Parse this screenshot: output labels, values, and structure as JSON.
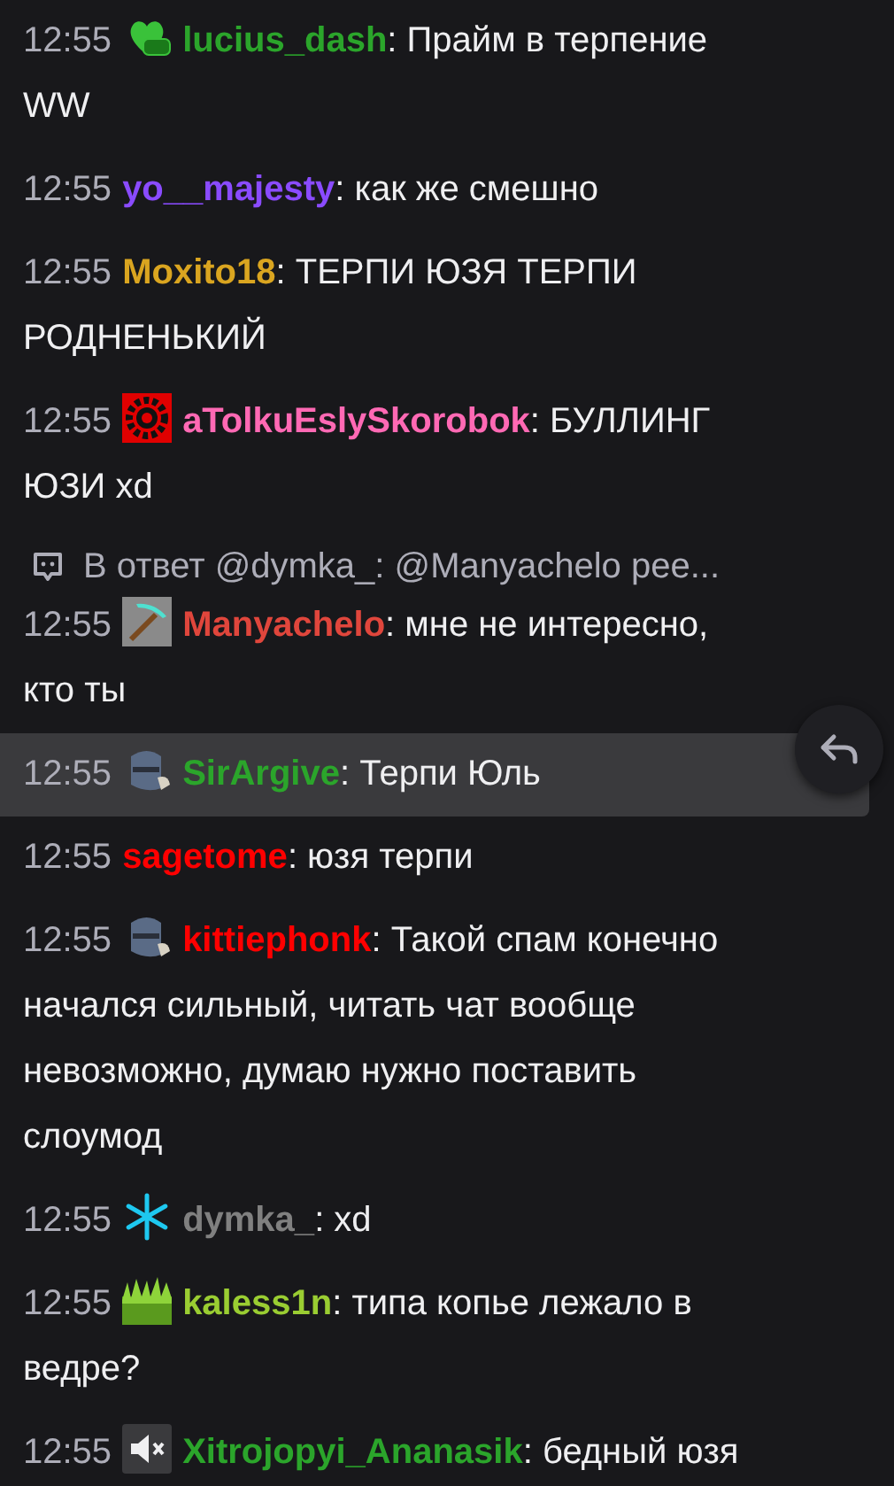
{
  "messages": [
    {
      "time": "12:55",
      "badge": {
        "kind": "heart"
      },
      "user": "lucius_dash",
      "color": "#2ba52b",
      "text": [
        ": Прайм в терпение",
        "WW"
      ],
      "highlighted": false
    },
    {
      "time": "12:55",
      "user": "yo__majesty",
      "color": "#8a4bff",
      "text": [
        ": как же смешно"
      ],
      "highlighted": false
    },
    {
      "time": "12:55",
      "user": "Moxito18",
      "color": "#daa520",
      "text": [
        ": ТЕРПИ ЮЗЯ ТЕРПИ",
        "РОДНЕНЬКИЙ"
      ],
      "highlighted": false
    },
    {
      "time": "12:55",
      "badge": {
        "kind": "gear"
      },
      "user": "aTolkuEslySkorobok",
      "color": "#ff69b4",
      "text": [
        ": БУЛЛИНГ",
        "ЮЗИ xd"
      ],
      "highlighted": false
    },
    {
      "reply": "В ответ @dymka_: @Manyachelo рее...",
      "time": "12:55",
      "badge": {
        "kind": "pickaxe"
      },
      "user": "Manyachelo",
      "color": "#e0463c",
      "text": [
        ": мне не интересно,",
        "кто ты"
      ],
      "highlighted": false
    },
    {
      "time": "12:55",
      "badge": {
        "kind": "helmet"
      },
      "user": "SirArgive",
      "color": "#2ba52b",
      "text": [
        ": Терпи Юль"
      ],
      "highlighted": true
    },
    {
      "time": "12:55",
      "user": "sagetome",
      "color": "#ff0000",
      "text": [
        ": юзя терпи"
      ],
      "highlighted": false
    },
    {
      "time": "12:55",
      "badge": {
        "kind": "helmet"
      },
      "user": "kittiephonk",
      "color": "#ff0000",
      "text": [
        ": Такой спам конечно",
        "начался сильный, читать чат вообще",
        "невозможно, думаю нужно поставить",
        "слоумод"
      ],
      "highlighted": false
    },
    {
      "time": "12:55",
      "badge": {
        "kind": "snowflake"
      },
      "user": "dymka_",
      "color": "#808080",
      "text": [
        ": xd"
      ],
      "highlighted": false
    },
    {
      "time": "12:55",
      "badge": {
        "kind": "grass"
      },
      "user": "kaless1n",
      "color": "#9acd32",
      "text": [
        ": типа копье лежало в",
        "ведре?"
      ],
      "highlighted": false
    },
    {
      "time": "12:55",
      "badge": {
        "kind": "mute"
      },
      "user": "Xitrojopyi_Ananasik",
      "color": "#2ba52b",
      "text": [
        ": бедный юзя"
      ],
      "highlighted": false
    }
  ]
}
